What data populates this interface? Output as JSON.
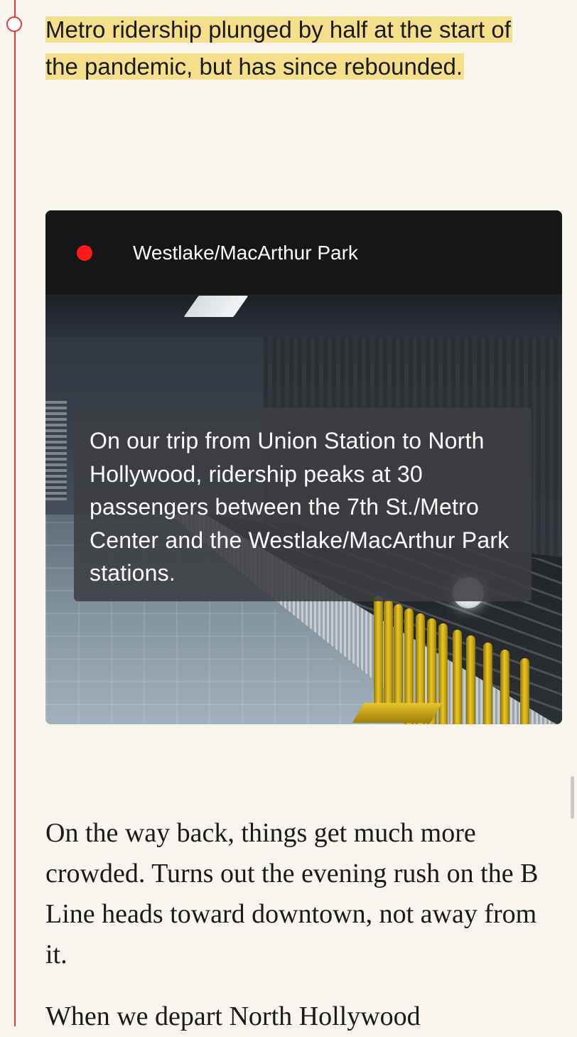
{
  "highlight": {
    "text": "Metro ridership plunged by half at the start of the pandemic, but has since rebounded."
  },
  "card": {
    "station_name": "Westlake/MacArthur Park",
    "caption": "On our trip from Union Station to North Hollywood, ridership peaks at 30 passengers between the 7th St./Metro Center and the Westlake/MacArthur Park stations.",
    "live_indicator_color": "#ff1a1a"
  },
  "article": {
    "paragraph_1": "On the way back, things get much more crowded. Turns out the evening rush on the B Line heads toward downtown, not away from it.",
    "paragraph_2": "When we depart North Hollywood"
  },
  "colors": {
    "timeline": "#e03a3a",
    "highlight": "#f6df8a",
    "background": "#f8f5ef"
  }
}
